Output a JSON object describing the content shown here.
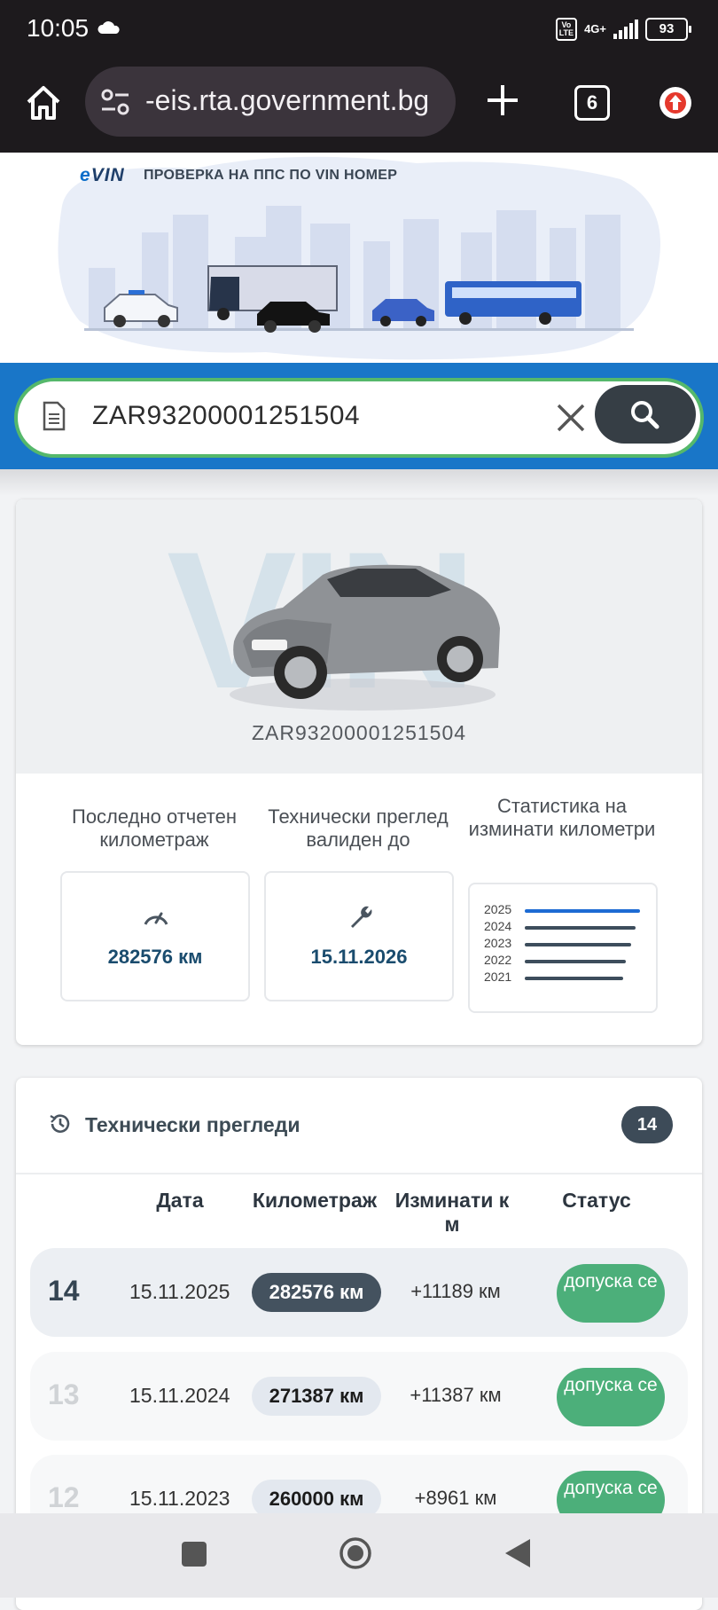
{
  "status_bar": {
    "time": "10:05",
    "volte": "Vo LTE",
    "network": "4G+",
    "battery": "93"
  },
  "browser": {
    "url": "-eis.rta.government.bg",
    "tab_count": "6"
  },
  "banner": {
    "logo_prefix": "e",
    "logo_main": "VIN",
    "title": "ПРОВЕРКА НА ППС ПО VIN НОМЕР"
  },
  "search": {
    "value": "ZAR93200001251504"
  },
  "vehicle": {
    "watermark": "VIN",
    "vin": "ZAR93200001251504",
    "mileage_label": "Последно отчетен километраж",
    "mileage_value": "282576 км",
    "inspection_label": "Технически преглед валиден до",
    "inspection_value": "15.11.2026",
    "stats_label": "Статистика на изминати километри",
    "stats_years": [
      "2025",
      "2024",
      "2023",
      "2022",
      "2021"
    ],
    "stats_bar_fractions": [
      1.0,
      0.96,
      0.92,
      0.88,
      0.85
    ]
  },
  "inspections": {
    "title": "Технически прегледи",
    "count": "14",
    "columns": {
      "date": "Дата",
      "mileage": "Километраж",
      "diff": "Изминати к м",
      "status": "Статус"
    },
    "rows": [
      {
        "num": "14",
        "date": "15.11.2025",
        "km": "282576 км",
        "diff": "+11189 км",
        "status": "допуска се",
        "active": true
      },
      {
        "num": "13",
        "date": "15.11.2024",
        "km": "271387 км",
        "diff": "+11387 км",
        "status": "допуска се",
        "active": false
      },
      {
        "num": "12",
        "date": "15.11.2023",
        "km": "260000 км",
        "diff": "+8961 км",
        "status": "допуска се",
        "active": false
      }
    ]
  },
  "colors": {
    "accent_blue": "#1976c8",
    "search_border": "#55b86b",
    "status_green": "#4caf7a",
    "dark_slate": "#3d4b58"
  }
}
